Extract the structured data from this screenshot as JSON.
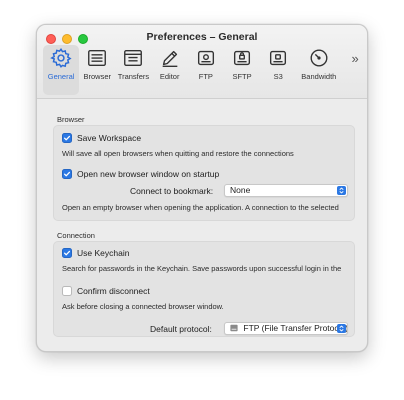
{
  "window": {
    "title": "Preferences – General"
  },
  "toolbar": {
    "items": [
      {
        "label": "General",
        "icon": "gear-icon",
        "active": true
      },
      {
        "label": "Browser",
        "icon": "browser-list-icon"
      },
      {
        "label": "Transfers",
        "icon": "transfers-icon"
      },
      {
        "label": "Editor",
        "icon": "pencil-icon"
      },
      {
        "label": "FTP",
        "icon": "ftp-drive-icon"
      },
      {
        "label": "SFTP",
        "icon": "sftp-drive-icon"
      },
      {
        "label": "S3",
        "icon": "s3-drive-icon"
      },
      {
        "label": "Bandwidth",
        "icon": "gauge-icon"
      }
    ],
    "more_glyph": "»"
  },
  "browser_section": {
    "title": "Browser",
    "save_workspace": {
      "label": "Save Workspace",
      "checked": true,
      "description": "Will save all open browsers when quitting and restore the connections"
    },
    "open_new_browser": {
      "label": "Open new browser window on startup",
      "checked": true,
      "bookmark_label": "Connect to bookmark:",
      "bookmark_value": "None",
      "description": "Open an empty browser when opening the application. A connection to the selected"
    }
  },
  "connection_section": {
    "title": "Connection",
    "use_keychain": {
      "label": "Use Keychain",
      "checked": true,
      "description": "Search for passwords in the Keychain. Save passwords upon successful login in the"
    },
    "confirm_disconnect": {
      "label": "Confirm disconnect",
      "checked": false,
      "description": "Ask before closing a connected browser window."
    },
    "default_protocol": {
      "label": "Default protocol:",
      "value": "FTP (File Transfer Protocol)"
    }
  },
  "colors": {
    "accent": "#2b78e4",
    "active_tab_label": "#2a6bd6"
  }
}
